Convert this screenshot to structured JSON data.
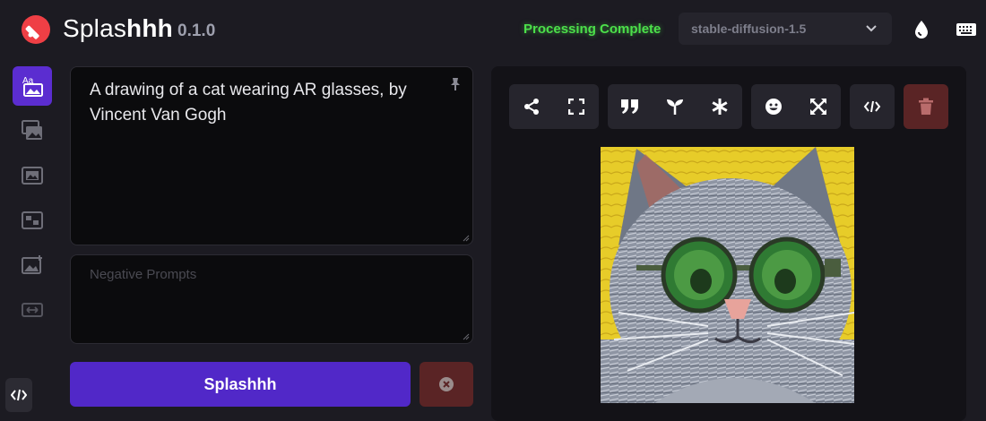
{
  "header": {
    "brand_regular": "Splas",
    "brand_bold": "hhh",
    "version": "0.1.0",
    "status": "Processing Complete",
    "model": {
      "selected": "stable-diffusion-1.5"
    },
    "icons": [
      "drop-icon",
      "keyboard-icon"
    ]
  },
  "sidebar": {
    "items": [
      {
        "name": "text-to-image",
        "icon": "text-image-icon",
        "active": true
      },
      {
        "name": "image-to-image",
        "icon": "images-icon",
        "active": false
      },
      {
        "name": "inpainting",
        "icon": "framed-image-icon",
        "active": false
      },
      {
        "name": "tiling",
        "icon": "tiles-icon",
        "active": false
      },
      {
        "name": "upscale",
        "icon": "image-plus-icon",
        "active": false
      },
      {
        "name": "resize",
        "icon": "expand-horizontal-icon",
        "active": false
      }
    ],
    "dev_icon": "code-icon"
  },
  "prompt": {
    "value": "A drawing of a cat wearing AR glasses, by Vincent Van Gogh"
  },
  "negative_prompt": {
    "value": "",
    "placeholder": "Negative Prompts"
  },
  "actions": {
    "generate_label": "Splashhh",
    "cancel_icon": "close-circle-icon"
  },
  "output_toolbar": {
    "groups": [
      [
        "share-icon",
        "fullscreen-icon"
      ],
      [
        "quote-icon",
        "seedling-icon",
        "asterisk-icon"
      ],
      [
        "face-icon",
        "expand-arrows-icon"
      ],
      [
        "code-icon"
      ],
      [
        "trash-icon"
      ]
    ]
  },
  "colors": {
    "accent": "#5128c8",
    "active_rail": "#5b2dd0",
    "status_green": "#4ce04a",
    "danger": "#5a2425",
    "logo_red": "#ef3f45"
  }
}
